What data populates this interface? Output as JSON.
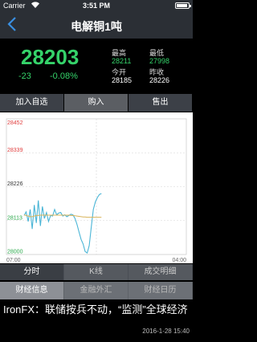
{
  "status": {
    "carrier": "Carrier",
    "time": "3:51 PM",
    "battery_level": 0.95
  },
  "header": {
    "title": "电解铜1吨"
  },
  "quote": {
    "price": "28203",
    "change": "-23",
    "change_pct": "-0.08%",
    "high_label": "最高",
    "high_value": "28211",
    "low_label": "最低",
    "low_value": "27998",
    "open_label": "今开",
    "open_value": "28185",
    "prev_close_label": "昨收",
    "prev_close_value": "28226"
  },
  "actions": {
    "add_label": "加入自选",
    "buy_label": "购入",
    "sell_label": "售出"
  },
  "chart_data": {
    "type": "line",
    "ylim": [
      28000,
      28452
    ],
    "y_ticks": [
      "28452",
      "28339",
      "28226",
      "28113",
      "28000"
    ],
    "x_labels": [
      "07:00",
      "04:00"
    ],
    "reference_value": 28226,
    "series": [
      {
        "values": [
          28130,
          28142,
          28110,
          28150,
          28085,
          28165,
          28105,
          28180,
          28095,
          28160,
          28120,
          28140,
          28110,
          28130,
          28128,
          28150,
          28132,
          28138,
          28140,
          28128,
          28132,
          28126,
          28130,
          28134,
          28132,
          28120,
          28100,
          28075,
          28050,
          28035,
          28010,
          28005,
          28030,
          28090,
          28150,
          28175,
          28190,
          28200,
          28203
        ]
      },
      {
        "values": [
          28132,
          28130,
          28128,
          28126,
          28126,
          28128,
          28130,
          28130,
          28131,
          28131,
          28131,
          28131,
          28131,
          28131,
          28131,
          28131,
          28131,
          28131,
          28131,
          28131,
          28131,
          28131,
          28131,
          28130,
          28130,
          28129,
          28128,
          28127,
          28126,
          28125,
          28125,
          28124,
          28124,
          28124,
          28124,
          28124,
          28124,
          28124,
          28124
        ]
      }
    ],
    "colors": {
      "price": "#4ab5d6",
      "average": "#d8b45a",
      "ticks_high": "#e04040",
      "ticks_mid": "#333333",
      "ticks_low": "#2aa84a"
    }
  },
  "period_tabs": [
    "分时",
    "K线",
    "成交明细"
  ],
  "news_tabs": [
    "财经信息",
    "金融外汇",
    "财经日历"
  ],
  "news": {
    "headline": "IronFX：联储按兵不动，“监测”全球经济",
    "date": "2016-1-28 15:40"
  }
}
